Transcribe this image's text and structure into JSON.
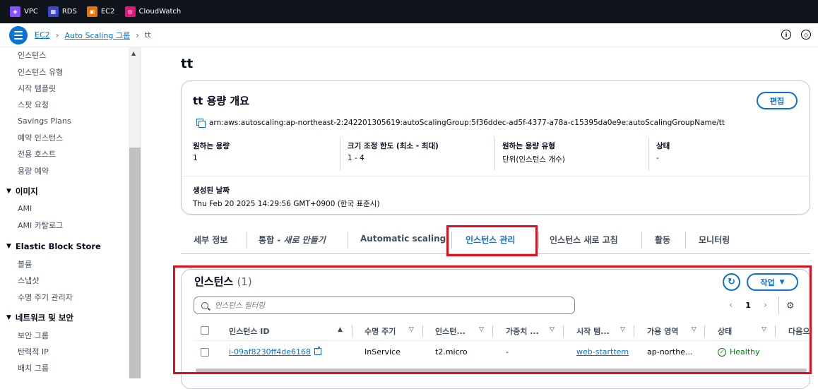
{
  "services": [
    {
      "label": "VPC",
      "icon": "vpc-icon",
      "color": "#8c4fff"
    },
    {
      "label": "RDS",
      "icon": "rds-icon",
      "color": "#3b48cc"
    },
    {
      "label": "EC2",
      "icon": "ec2-icon",
      "color": "#ed7100"
    },
    {
      "label": "CloudWatch",
      "icon": "cloudwatch-icon",
      "color": "#e7157b"
    }
  ],
  "breadcrumb": {
    "root": "EC2",
    "parent": "Auto Scaling 그룹",
    "current": "tt"
  },
  "sidebar": {
    "items_top": [
      "인스턴스",
      "인스턴스 유형",
      "시작 템플릿",
      "스팟 요청",
      "Savings Plans",
      "예약 인스턴스",
      "전용 호스트",
      "용량 예약"
    ],
    "sections": [
      {
        "title": "이미지",
        "items": [
          "AMI",
          "AMI 카탈로그"
        ]
      },
      {
        "title": "Elastic Block Store",
        "items": [
          "볼륨",
          "스냅샷",
          "수명 주기 관리자"
        ]
      },
      {
        "title": "네트워크 및 보안",
        "items": [
          "보안 그룹",
          "탄력적 IP",
          "배치 그룹"
        ]
      }
    ]
  },
  "page": {
    "title": "tt"
  },
  "overview": {
    "title": "tt 용량 개요",
    "edit_label": "편집",
    "arn": "arn:aws:autoscaling:ap-northeast-2:242201305619:autoScalingGroup:5f36ddec-ad5f-4377-a78a-c15395da0e9e:autoScalingGroupName/tt",
    "fields": [
      {
        "label": "원하는 용량",
        "value": "1"
      },
      {
        "label": "크기 조정 한도 (최소 - 최대)",
        "value": "1 - 4"
      },
      {
        "label": "원하는 용량 유형",
        "value": "단위(인스턴스 개수)"
      },
      {
        "label": "상태",
        "value": "-"
      }
    ],
    "created": {
      "label": "생성된 날짜",
      "value": "Thu Feb 20 2025 14:29:56 GMT+0900 (한국 표준시)"
    }
  },
  "tabs": {
    "details": "세부 정보",
    "integration_prefix": "통합 - ",
    "integration_new": "새로 만들기",
    "scaling": "Automatic scaling",
    "instances": "인스턴스 관리",
    "refresh": "인스턴스 새로 고침",
    "activity": "활동",
    "monitoring": "모니터링"
  },
  "instances": {
    "title": "인스턴스",
    "count": "(1)",
    "actions_label": "작업",
    "filter_placeholder": "인스턴스 필터링",
    "page": "1",
    "columns": [
      "인스턴스 ID",
      "수명 주기",
      "인스턴...",
      "가중치 ...",
      "시작 템...",
      "가용 영역",
      "상태",
      "다음으"
    ],
    "rows": [
      {
        "id": "i-09af8230ff4de6168",
        "lifecycle": "InService",
        "type": "t2.micro",
        "weight": "-",
        "template": "web-starttem",
        "az": "ap-northe...",
        "status": "Healthy"
      }
    ]
  }
}
